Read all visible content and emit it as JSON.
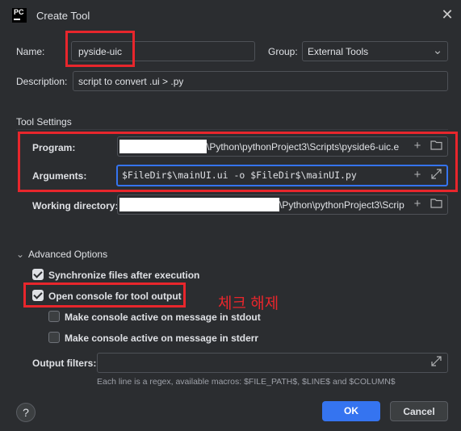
{
  "window": {
    "title": "Create Tool",
    "logo_text": "PC"
  },
  "form": {
    "name_label": "Name:",
    "name_value": "pyside-uic",
    "group_label": "Group:",
    "group_value": "External Tools",
    "description_label": "Description:",
    "description_value": "script to convert .ui > .py"
  },
  "tool_settings": {
    "title": "Tool Settings",
    "program_label": "Program:",
    "program_value": "\\Python\\pythonProject3\\Scripts\\pyside6-uic.e",
    "arguments_label": "Arguments:",
    "arguments_value": "$FileDir$\\mainUI.ui -o $FileDir$\\mainUI.py",
    "workdir_label": "Working directory:",
    "workdir_value": "\\Python\\pythonProject3\\Scrip"
  },
  "advanced": {
    "title": "Advanced Options",
    "sync_label": "Synchronize files after execution",
    "sync_checked": true,
    "console_label": "Open console for tool output",
    "console_checked": true,
    "stdout_label": "Make console active on message in stdout",
    "stdout_checked": false,
    "stderr_label": "Make console active on message in stderr",
    "stderr_checked": false,
    "filters_label": "Output filters:",
    "hint": "Each line is a regex, available macros: $FILE_PATH$, $LINE$ and $COLUMN$"
  },
  "annotation": "체크 해제",
  "buttons": {
    "ok": "OK",
    "cancel": "Cancel",
    "help": "?"
  }
}
